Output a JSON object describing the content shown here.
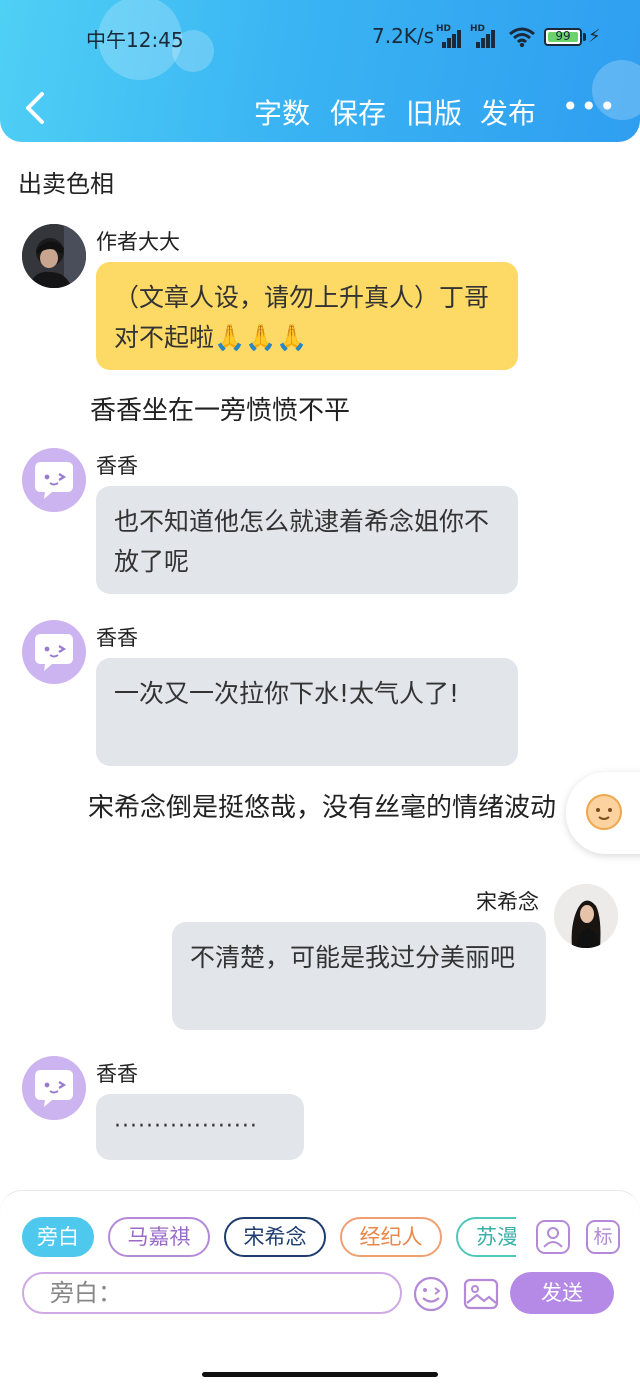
{
  "status_bar": {
    "time": "中午12:45",
    "net_speed": "7.2K/s",
    "battery": "99"
  },
  "header": {
    "buttons": [
      "字数",
      "保存",
      "旧版",
      "发布"
    ],
    "more": "•••"
  },
  "title": "出卖色相",
  "messages": {
    "m1_name": "作者大大",
    "m1_text": "（文章人设，请勿上升真人）丁哥对不起啦🙏🙏🙏",
    "n1": "香香坐在一旁愤愤不平",
    "m2_name": "香香",
    "m2_text": "也不知道他怎么就逮着希念姐你不放了呢",
    "m3_name": "香香",
    "m3_text": "一次又一次拉你下水!太气人了!",
    "n2": "宋希念倒是挺悠哉，没有丝毫的情绪波动",
    "m4_name": "宋希念",
    "m4_text": "不清楚，可能是我过分美丽吧",
    "m5_name": "香香",
    "m5_text": "··················"
  },
  "characters": [
    "旁白",
    "马嘉祺",
    "宋希念",
    "经纪人",
    "苏漫"
  ],
  "character_colors": [
    "#4fc8ee",
    "#b48ad8",
    "#1e3d6e",
    "#f0a070",
    "#4fc8b8"
  ],
  "tool_icon_label": "标",
  "input": {
    "placeholder": "旁白："
  },
  "send_label": "发送"
}
